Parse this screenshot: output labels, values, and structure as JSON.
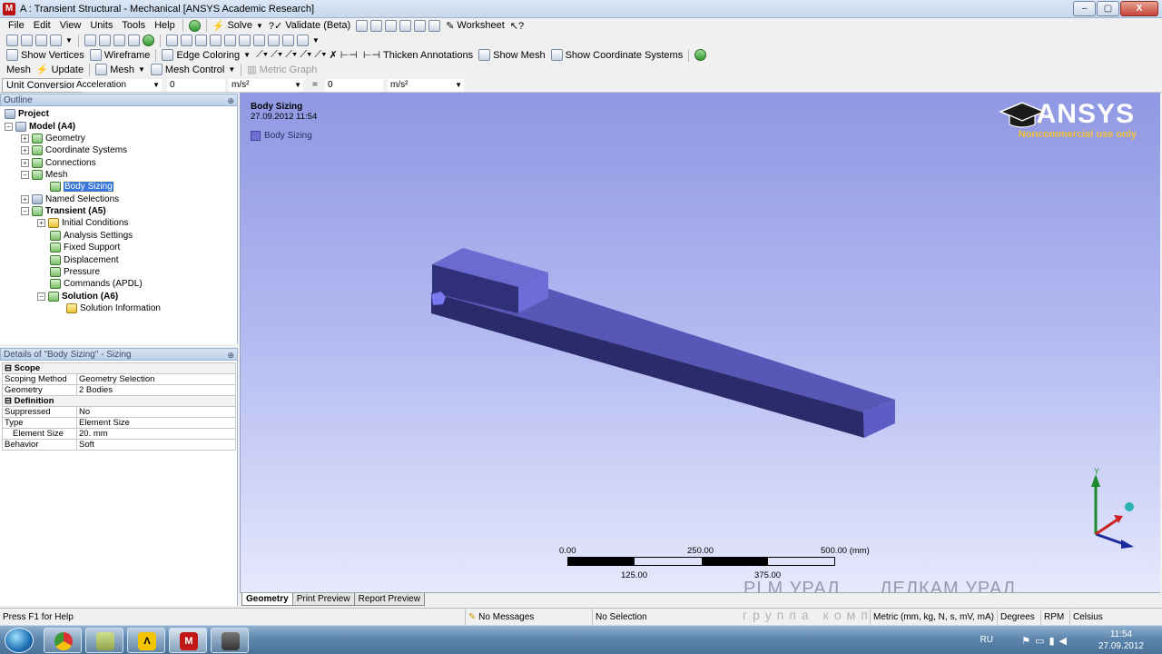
{
  "window": {
    "title": "A : Transient Structural - Mechanical [ANSYS Academic Research]",
    "app_icon_letter": "M",
    "buttons": [
      "–",
      "▢",
      "X"
    ]
  },
  "menu": {
    "items": [
      "File",
      "Edit",
      "View",
      "Units",
      "Tools",
      "Help"
    ]
  },
  "toolbar1": {
    "solve": "Solve",
    "validate": "Validate (Beta)",
    "worksheet": "Worksheet"
  },
  "toolbar2": {
    "show_vertices": "Show Vertices",
    "wireframe": "Wireframe",
    "edge_coloring": "Edge Coloring",
    "thicken_annotations": "Thicken Annotations",
    "show_mesh": "Show Mesh",
    "show_coordinate_systems": "Show Coordinate Systems"
  },
  "toolbar3": {
    "context": "Mesh",
    "update": "Update",
    "mesh": "Mesh",
    "mesh_control": "Mesh Control",
    "metric_graph": "Metric Graph"
  },
  "unit_conversion": {
    "label": "Unit Conversion",
    "quantity": "Acceleration",
    "value_left": "0",
    "unit_left": "m/s²",
    "equals": "=",
    "value_right": "0",
    "unit_right": "m/s²"
  },
  "outline": {
    "header": "Outline",
    "items": [
      {
        "label": "Project",
        "bold": true
      },
      {
        "label": "Model (A4)",
        "bold": true
      },
      {
        "label": "Geometry"
      },
      {
        "label": "Coordinate Systems"
      },
      {
        "label": "Connections"
      },
      {
        "label": "Mesh"
      },
      {
        "label": "Body Sizing",
        "selected": true
      },
      {
        "label": "Named Selections"
      },
      {
        "label": "Transient (A5)",
        "bold": true
      },
      {
        "label": "Initial Conditions"
      },
      {
        "label": "Analysis Settings"
      },
      {
        "label": "Fixed Support"
      },
      {
        "label": "Displacement"
      },
      {
        "label": "Pressure"
      },
      {
        "label": "Commands (APDL)"
      },
      {
        "label": "Solution (A6)",
        "bold": true
      },
      {
        "label": "Solution Information"
      }
    ]
  },
  "details": {
    "header": "Details of \"Body Sizing\" - Sizing",
    "sections": [
      {
        "title": "Scope",
        "rows": [
          {
            "key": "Scoping Method",
            "value": "Geometry Selection"
          },
          {
            "key": "Geometry",
            "value": "2 Bodies"
          }
        ]
      },
      {
        "title": "Definition",
        "rows": [
          {
            "key": "Suppressed",
            "value": "No"
          },
          {
            "key": "Type",
            "value": "Element Size"
          },
          {
            "key": "Element Size",
            "value": "20. mm"
          },
          {
            "key": "Behavior",
            "value": "Soft"
          }
        ]
      }
    ]
  },
  "viewport": {
    "title": "Body Sizing",
    "date": "27.09.2012 11:54",
    "legend_label": "Body Sizing",
    "legend_color": "#6e6ed4",
    "logo_text": "ANSYS",
    "logo_subtitle": "Noncommercial use only",
    "scale": {
      "top_labels": [
        "0.00",
        "250.00",
        "500.00 (mm)"
      ],
      "bottom_labels": [
        "125.00",
        "375.00"
      ]
    },
    "triad": {
      "y_label": "Y"
    },
    "watermark_left": "PLM УРАЛ",
    "watermark_right": "ДЕЛКАМ УРАЛ"
  },
  "tabs": [
    "Geometry",
    "Print Preview",
    "Report Preview"
  ],
  "statusbar": {
    "help": "Press F1 for Help",
    "messages": "No Messages",
    "selection": "No Selection",
    "units": "Metric (mm, kg, N, s, mV, mA)",
    "angle": "Degrees",
    "speed": "RPM",
    "temp": "Celsius",
    "watermark": "группа комп"
  },
  "taskbar": {
    "lang": "RU",
    "time": "11:54",
    "date": "27.09.2012"
  }
}
